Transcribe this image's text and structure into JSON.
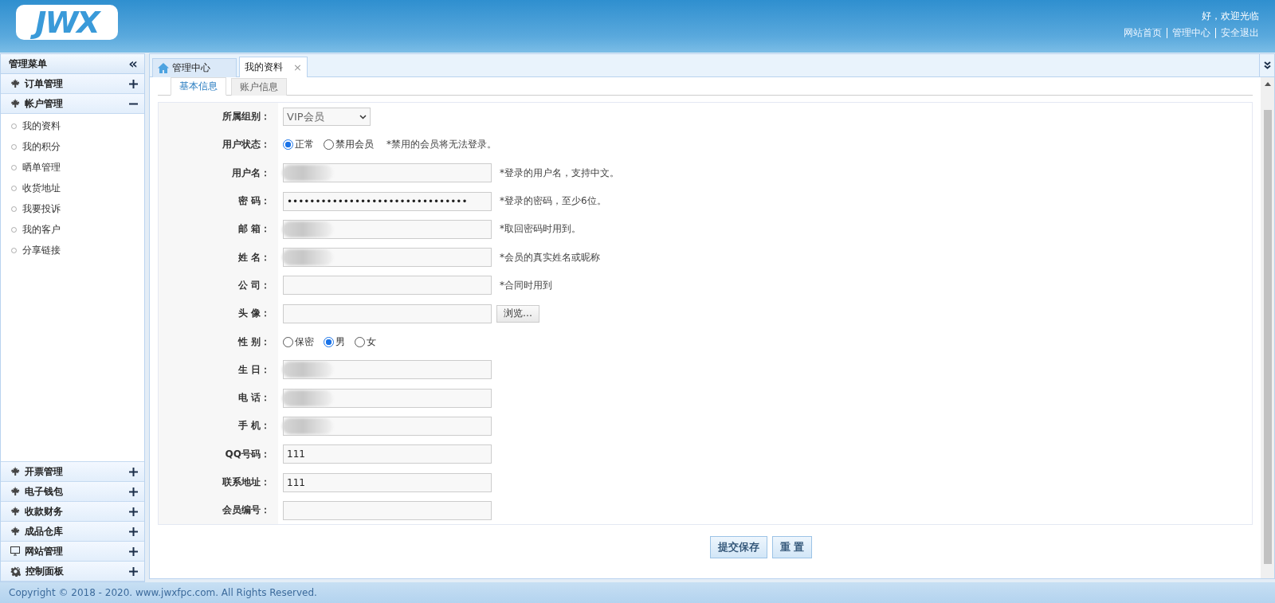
{
  "header": {
    "logo": "JWX",
    "greeting": "好，欢迎光临",
    "links": [
      "网站首页",
      "管理中心",
      "安全退出"
    ]
  },
  "sidebar": {
    "title": "管理菜单",
    "collapse_glyph": "«",
    "sections": [
      {
        "label": "订单管理",
        "kind": "leaf",
        "expanded": false
      },
      {
        "label": "帐户管理",
        "kind": "leaf",
        "expanded": true,
        "children": [
          "我的资料",
          "我的积分",
          "晒单管理",
          "收货地址",
          "我要投诉",
          "我的客户",
          "分享链接"
        ]
      },
      {
        "label": "开票管理",
        "kind": "leaf",
        "expanded": false
      },
      {
        "label": "电子钱包",
        "kind": "leaf",
        "expanded": false
      },
      {
        "label": "收款财务",
        "kind": "leaf",
        "expanded": false
      },
      {
        "label": "成品仓库",
        "kind": "leaf",
        "expanded": false
      },
      {
        "label": "网站管理",
        "kind": "monitor",
        "expanded": false
      },
      {
        "label": "控制面板",
        "kind": "gear",
        "expanded": false
      }
    ]
  },
  "tabs": [
    {
      "label": "管理中心",
      "kind": "home",
      "selected": false
    },
    {
      "label": "我的资料",
      "kind": "closable",
      "close": "×",
      "selected": true
    }
  ],
  "sub_tabs": [
    {
      "label": "基本信息",
      "selected": true
    },
    {
      "label": "账户信息",
      "selected": false
    }
  ],
  "form": [
    {
      "label": "所属组别：",
      "kind": "select",
      "value": "VIP会员"
    },
    {
      "label": "用户状态：",
      "kind": "radio",
      "options": [
        {
          "label": "正常",
          "selected": true
        },
        {
          "label": "禁用会员",
          "selected": false
        }
      ],
      "hint": "*禁用的会员将无法登录。"
    },
    {
      "label": "用户名：",
      "kind": "text",
      "redacted": true,
      "hint": "*登录的用户名，支持中文。"
    },
    {
      "label": "密 码：",
      "kind": "text",
      "value": "••••••••••••••••••••••••••••••••",
      "hint": "*登录的密码，至少6位。"
    },
    {
      "label": "邮 箱：",
      "kind": "text",
      "redacted": true,
      "hint": "*取回密码时用到。"
    },
    {
      "label": "姓 名：",
      "kind": "text",
      "redacted": true,
      "hint": "*会员的真实姓名或昵称"
    },
    {
      "label": "公 司：",
      "kind": "text",
      "hint": "*合同时用到"
    },
    {
      "label": "头 像：",
      "kind": "file",
      "button": "浏览…"
    },
    {
      "label": "性 别：",
      "kind": "radio",
      "options": [
        {
          "label": "保密",
          "selected": false
        },
        {
          "label": "男",
          "selected": true
        },
        {
          "label": "女",
          "selected": false
        }
      ]
    },
    {
      "label": "生 日：",
      "kind": "text",
      "redacted": true
    },
    {
      "label": "电 话：",
      "kind": "text",
      "redacted": true
    },
    {
      "label": "手 机：",
      "kind": "text",
      "redacted": true
    },
    {
      "label": "QQ号码：",
      "kind": "text",
      "value": "111"
    },
    {
      "label": "联系地址：",
      "kind": "text",
      "value": "111"
    },
    {
      "label": "会员编号：",
      "kind": "text"
    }
  ],
  "buttons": [
    "提交保存",
    "重 置"
  ],
  "footer": "Copyright © 2018 - 2020. www.jwxfpc.com. All Rights Reserved."
}
